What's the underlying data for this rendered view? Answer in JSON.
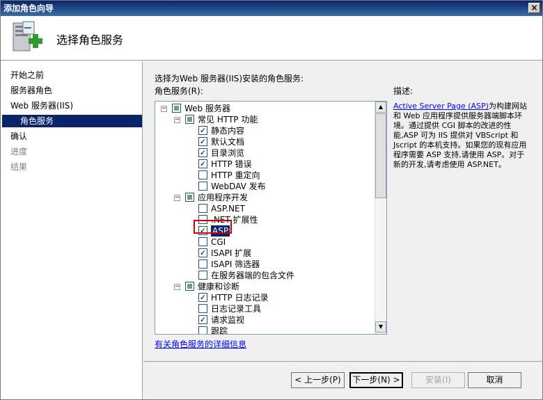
{
  "window": {
    "title": "添加角色向导"
  },
  "header": {
    "title": "选择角色服务"
  },
  "nav": {
    "items": [
      {
        "label": "开始之前",
        "state": "normal"
      },
      {
        "label": "服务器角色",
        "state": "normal"
      },
      {
        "label": "Web 服务器(IIS)",
        "state": "normal"
      },
      {
        "label": "角色服务",
        "state": "selected"
      },
      {
        "label": "确认",
        "state": "normal"
      },
      {
        "label": "进度",
        "state": "disabled"
      },
      {
        "label": "结果",
        "state": "disabled"
      }
    ]
  },
  "main": {
    "instruction": "选择为Web 服务器(IIS)安装的角色服务:",
    "tree_label": "角色服务(R):",
    "description_label": "描述:",
    "description_link": "Active Server Page (ASP)",
    "description_text": "为构建网站和 Web 应用程序提供服务器端脚本环境。通过提供 CGI 脚本的改进的性能,ASP 可为 IIS 提供对 VBScript 和 Jscript 的本机支持。如果您的现有应用程序需要 ASP 支持,请使用 ASP。对于新的开发,请考虑使用 ASP.NET。",
    "more_info_link": "有关角色服务的详细信息"
  },
  "tree": {
    "items": [
      {
        "label": "Web 服务器",
        "level": 0,
        "expander": "−",
        "check": "partial"
      },
      {
        "label": "常见 HTTP 功能",
        "level": 1,
        "expander": "−",
        "check": "partial"
      },
      {
        "label": "静态内容",
        "level": 2,
        "check": "checked"
      },
      {
        "label": "默认文档",
        "level": 2,
        "check": "checked"
      },
      {
        "label": "目录浏览",
        "level": 2,
        "check": "checked"
      },
      {
        "label": "HTTP 错误",
        "level": 2,
        "check": "checked"
      },
      {
        "label": "HTTP 重定向",
        "level": 2,
        "check": "unchecked"
      },
      {
        "label": "WebDAV 发布",
        "level": 2,
        "check": "unchecked"
      },
      {
        "label": "应用程序开发",
        "level": 1,
        "expander": "−",
        "check": "partial"
      },
      {
        "label": "ASP.NET",
        "level": 2,
        "check": "unchecked"
      },
      {
        "label": ".NET 扩展性",
        "level": 2,
        "check": "unchecked"
      },
      {
        "label": "ASP",
        "level": 2,
        "check": "checked",
        "selected": true
      },
      {
        "label": "CGI",
        "level": 2,
        "check": "unchecked"
      },
      {
        "label": "ISAPI 扩展",
        "level": 2,
        "check": "checked"
      },
      {
        "label": "ISAPI 筛选器",
        "level": 2,
        "check": "unchecked"
      },
      {
        "label": "在服务器端的包含文件",
        "level": 2,
        "check": "unchecked"
      },
      {
        "label": "健康和诊断",
        "level": 1,
        "expander": "−",
        "check": "partial"
      },
      {
        "label": "HTTP 日志记录",
        "level": 2,
        "check": "checked"
      },
      {
        "label": "日志记录工具",
        "level": 2,
        "check": "unchecked"
      },
      {
        "label": "请求监视",
        "level": 2,
        "check": "checked"
      },
      {
        "label": "跟踪",
        "level": 2,
        "check": "unchecked"
      }
    ]
  },
  "footer": {
    "prev": "< 上一步(P)",
    "next": "下一步(N) >",
    "install": "安装(I)",
    "cancel": "取消"
  },
  "icons": {
    "close": "close-icon",
    "wizard": "server-add-icon"
  }
}
